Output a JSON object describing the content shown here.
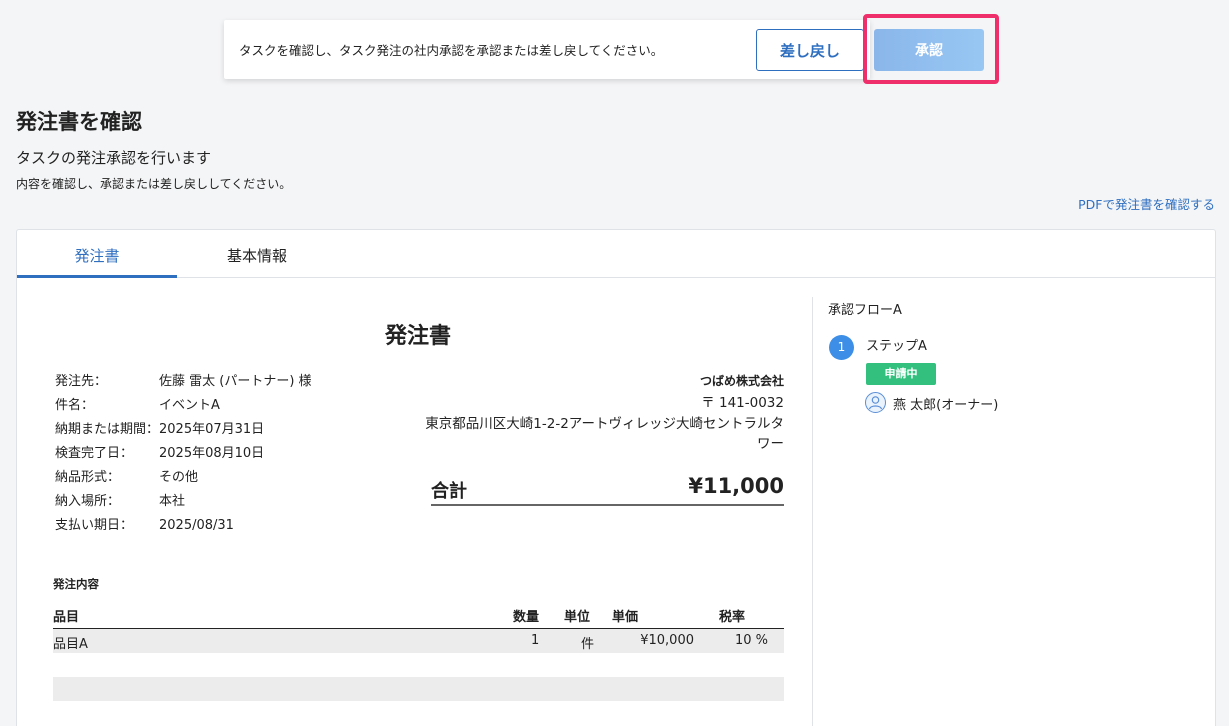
{
  "approval_bar": {
    "message": "タスクを確認し、タスク発注の社内承認を承認または差し戻してください。",
    "return_label": "差し戻し",
    "approve_label": "承認"
  },
  "header": {
    "title": "発注書を確認",
    "subtitle": "タスクの発注承認を行います",
    "description": "内容を確認し、承認または差し戻ししてください。",
    "pdf_link": "PDFで発注書を確認する"
  },
  "tabs": [
    {
      "label": "発注書",
      "active": true
    },
    {
      "label": "基本情報",
      "active": false
    }
  ],
  "document": {
    "title": "発注書",
    "info_labels": [
      "発注先：",
      "件名：",
      "納期または期間：",
      "検査完了日：",
      "納品形式：",
      "納入場所：",
      "支払い期日："
    ],
    "info_values": [
      "佐藤 雷太 (パートナー) 様",
      "イベントA",
      "2025年07月31日",
      "2025年08月10日",
      "その他",
      "本社",
      "2025/08/31"
    ],
    "vendor": {
      "name": "つばめ株式会社",
      "zip": "〒 141-0032",
      "address_line1": "東京都品川区大崎1-2-2アートヴィレッジ大崎セントラルタ",
      "address_line2": "ワー"
    },
    "total": {
      "label": "合計",
      "value": "¥11,000"
    },
    "items_section_label": "発注内容",
    "table": {
      "headers": {
        "name": "品目",
        "qty": "数量",
        "unit": "単位",
        "price": "単価",
        "tax": "税率"
      },
      "rows": [
        {
          "name": "品目A",
          "qty": "1",
          "unit": "件",
          "price": "¥10,000",
          "tax": "10 %"
        }
      ]
    }
  },
  "approval_flow": {
    "title": "承認フローA",
    "steps": [
      {
        "number": "1",
        "name": "ステップA",
        "status": "申請中",
        "approver": "燕 太郎(オーナー)"
      }
    ]
  },
  "colors": {
    "accent": "#2f6fc0",
    "highlight": "#ef2f6c",
    "status_green": "#33c07e",
    "step_blue": "#3d8ee6"
  }
}
